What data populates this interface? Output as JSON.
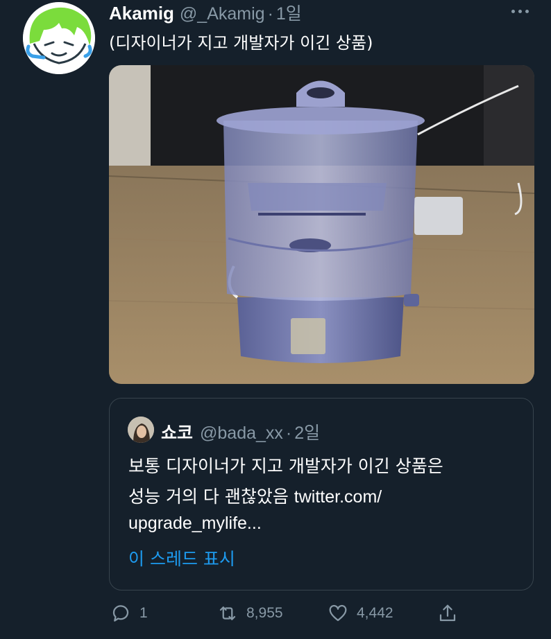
{
  "tweet": {
    "author_name": "Akamig",
    "author_handle": "@_Akamig",
    "separator": "·",
    "time": "1일",
    "text": "(디자이너가 지고 개발자가 이긴 상품)",
    "avatar_icon": "green-hair-cartoon-avatar",
    "media_description_icon": "water-dispenser-photo"
  },
  "quote": {
    "author_name": "쇼코",
    "author_handle": "@bada_xx",
    "separator": "·",
    "time": "2일",
    "line1": "보통 디자이너가 지고 개발자가 이긴 상품은",
    "line2_ko": "성능 거의 다 괜찮았음 ",
    "line2_link": "twitter.com/",
    "line3": "upgrade_mylife...",
    "show_thread": "이 스레드 표시"
  },
  "actions": {
    "reply_count": "1",
    "retweet_count": "8,955",
    "like_count": "4,442"
  },
  "colors": {
    "background": "#15202b",
    "secondary_text": "#8899a6",
    "link": "#1d9bf0",
    "border": "#38444d"
  }
}
